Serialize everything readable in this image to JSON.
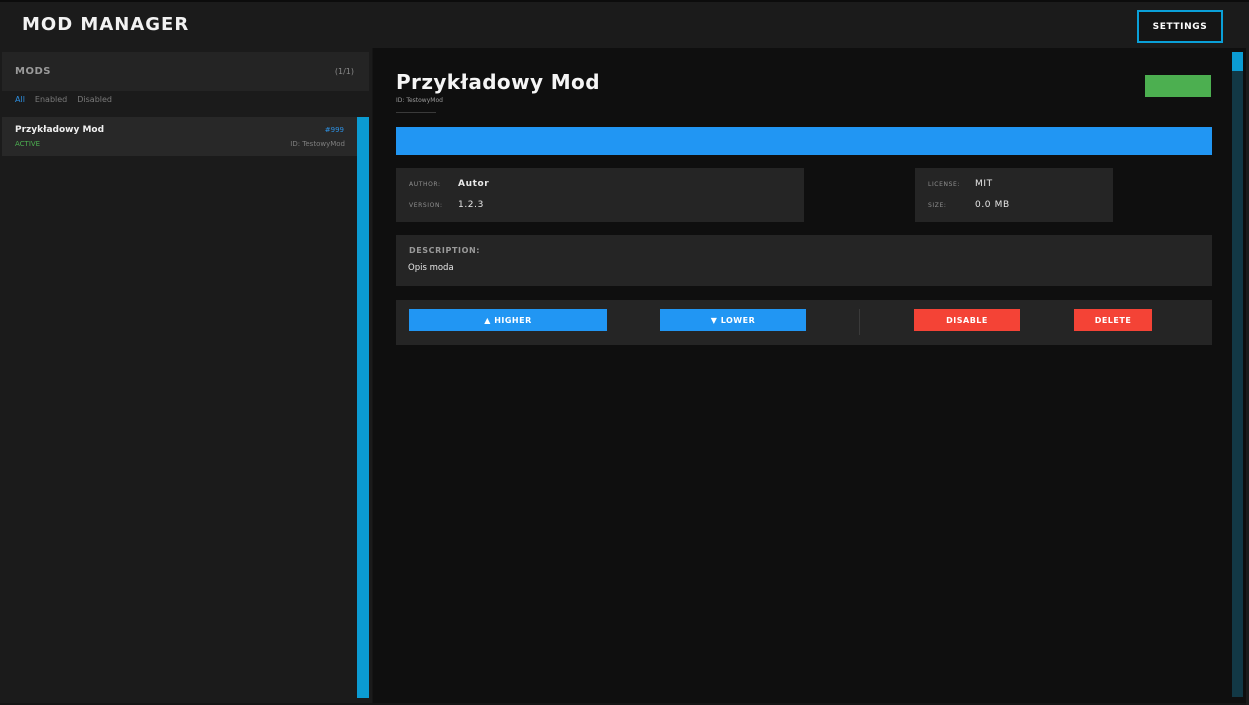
{
  "app": {
    "title": "MOD MANAGER",
    "settings_label": "SETTINGS"
  },
  "sidebar": {
    "header": "MODS",
    "count": "(1/1)",
    "filters": [
      "All",
      "Enabled",
      "Disabled"
    ],
    "active_filter": "All",
    "items": [
      {
        "name": "Przykładowy Mod",
        "number": "#999",
        "status": "ACTIVE",
        "id": "ID: TestowyMod"
      }
    ]
  },
  "detail": {
    "title": "Przykładowy Mod",
    "id": "ID: TestowyMod",
    "status_color": "#4caf50",
    "banner_color": "#2196f3",
    "author_key": "AUTHOR:",
    "author": "Autor",
    "version_key": "VERSION:",
    "version": "1.2.3",
    "license_key": "LICENSE:",
    "license": "MIT",
    "size_key": "SIZE:",
    "size": "0.0 MB",
    "description_label": "DESCRIPTION:",
    "description": "Opis moda"
  },
  "actions": {
    "higher": "▲ HIGHER",
    "lower": "▼ LOWER",
    "disable": "DISABLE",
    "delete": "DELETE"
  },
  "colors": {
    "accent": "#0b9bd2",
    "primary": "#2196f3",
    "danger": "#f44336",
    "success": "#4caf50"
  }
}
